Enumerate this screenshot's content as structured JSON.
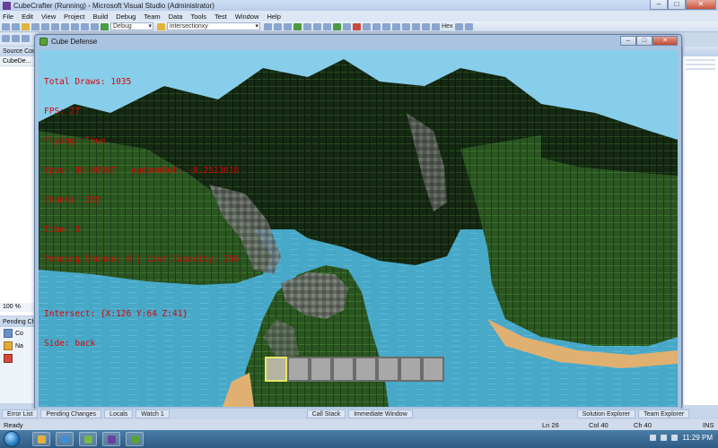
{
  "vs": {
    "title": "CubeCrafter (Running) - Microsoft Visual Studio (Administrator)",
    "menu": [
      "File",
      "Edit",
      "View",
      "Project",
      "Build",
      "Debug",
      "Team",
      "Data",
      "Tools",
      "Test",
      "Window",
      "Help"
    ],
    "toolbar": {
      "config_combo": "Debug",
      "find_combo": "intersectionxy",
      "hex_label": "Hex"
    },
    "left_pane": {
      "header": "Source Control...",
      "tab": "CubeDe...",
      "zoom": "100 %"
    },
    "pending_pane": {
      "header": "Pending Changes",
      "rows": [
        "Co",
        "Na"
      ]
    },
    "bottom_tabs": [
      "Error List",
      "Pending Changes",
      "Locals",
      "Watch 1",
      "Call Stack",
      "Immediate Window",
      "Solution Explorer",
      "Team Explorer"
    ],
    "status": {
      "ready": "Ready",
      "ln": "Ln 26",
      "col": "Col 40",
      "ch": "Ch 40",
      "ins": "INS"
    }
  },
  "game": {
    "title": "Cube Defense",
    "hud": {
      "draws": "Total Draws: 1035",
      "fps": "FPS: 27",
      "flying": "Flying: True",
      "ypos": "Ypos: 88.00397 | updownRot: -0.2513616",
      "chunks": "Chunks: 255",
      "time": "Time: 0",
      "pending": "Pending Chunks: 0 | List Capacity: 256",
      "intersect": "Intersect: {X:126 Y:64 Z:41}",
      "side": "Side: back"
    },
    "hotbar": {
      "slot_count": 8,
      "selected_index": 0
    },
    "colors": {
      "hud_text": "#e00000",
      "sky": "#87ceeb",
      "water": "#47a8c8",
      "grass": "#2e5a22",
      "sand": "#e0b070"
    }
  },
  "taskbar": {
    "clock": "11:29 PM"
  }
}
